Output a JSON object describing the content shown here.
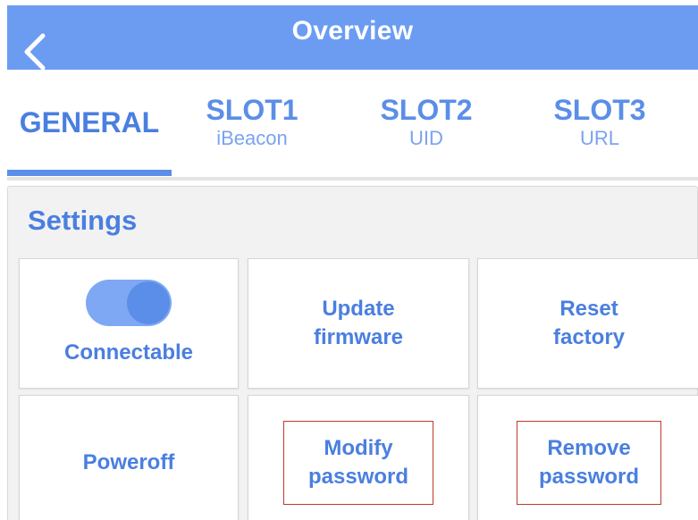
{
  "navbar": {
    "title": "Overview",
    "back_icon": "chevron-left-icon",
    "background_color": "#6b9cf2"
  },
  "tabs": [
    {
      "label": "GENERAL",
      "sub": "",
      "active": true
    },
    {
      "label": "SLOT1",
      "sub": "iBeacon",
      "active": false
    },
    {
      "label": "SLOT2",
      "sub": "UID",
      "active": false
    },
    {
      "label": "SLOT3",
      "sub": "URL",
      "active": false
    }
  ],
  "settings": {
    "title": "Settings",
    "connectable": {
      "label": "Connectable",
      "toggle_on": true
    },
    "update_firmware": {
      "label": "Update\nfirmware"
    },
    "reset_factory": {
      "label": "Reset\nfactory"
    },
    "poweroff": {
      "label": "Poweroff"
    },
    "modify_password": {
      "label": "Modify\npassword",
      "highlighted": true
    },
    "remove_password": {
      "label": "Remove\npassword",
      "highlighted": true
    }
  },
  "colors": {
    "accent": "#4a7fe0",
    "highlight_border": "#c0392b"
  }
}
